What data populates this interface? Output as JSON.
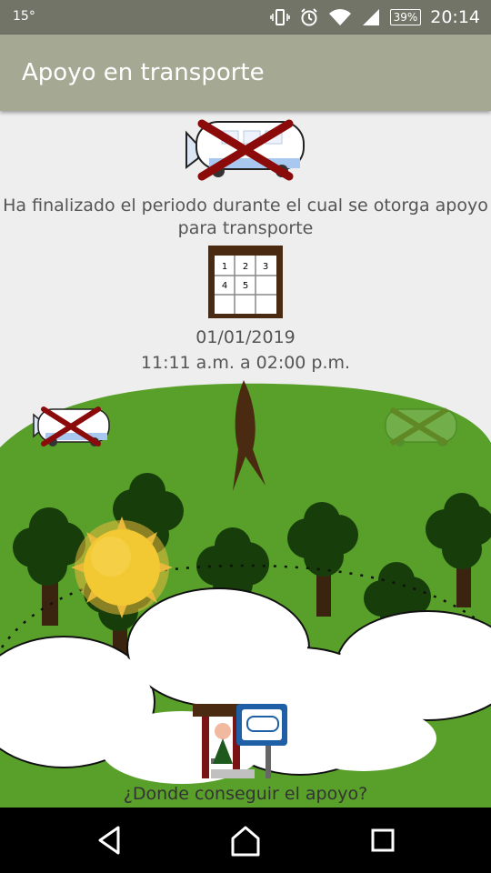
{
  "status_bar": {
    "temperature": "15°",
    "battery": "39%",
    "time": "20:14"
  },
  "app_bar": {
    "title": "Apoyo en transporte"
  },
  "notice": {
    "message": "Ha finalizado el periodo durante el cual se otorga apoyo para transporte"
  },
  "calendar": {
    "days": [
      "1",
      "2",
      "3",
      "4",
      "5"
    ]
  },
  "schedule": {
    "date": "01/01/2019",
    "hours": "11:11 a.m. a 02:00 p.m."
  },
  "footer": {
    "link": "¿Donde conseguir el apoyo?"
  },
  "colors": {
    "app_bar": "#a5a892",
    "status_bar": "#727468",
    "hill": "#59a02a",
    "tree": "#173d0b",
    "sun": "#f2c932",
    "cross": "#8b0a0a"
  },
  "icons": [
    "vibrate-icon",
    "alarm-icon",
    "wifi-icon",
    "signal-icon",
    "battery-icon",
    "back-icon",
    "home-icon",
    "recents-icon"
  ]
}
